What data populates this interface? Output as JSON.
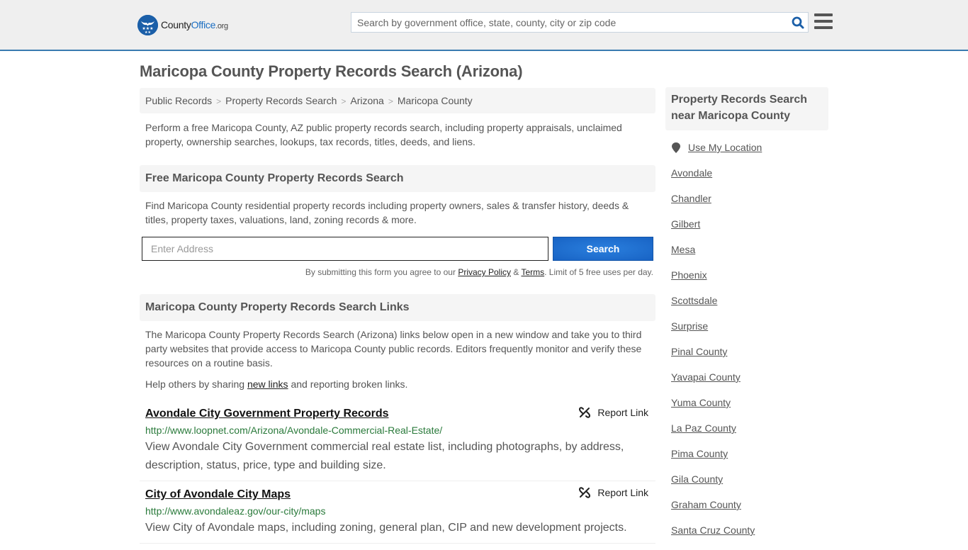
{
  "header": {
    "logo": {
      "county": "County",
      "office": "Office",
      "org": ".org"
    },
    "search_placeholder": "Search by government office, state, county, city or zip code",
    "icons": {
      "search": "search-icon",
      "menu": "hamburger-menu-icon",
      "logo": "eagle-stars-badge"
    },
    "colors": {
      "accent": "#1b6ec2",
      "border": "#3a7bb0"
    }
  },
  "page": {
    "title": "Maricopa County Property Records Search (Arizona)",
    "breadcrumb": [
      "Public Records",
      "Property Records Search",
      "Arizona",
      "Maricopa County"
    ],
    "breadcrumb_sep": ">",
    "intro": "Perform a free Maricopa County, AZ public property records search, including property appraisals, unclaimed property, ownership searches, lookups, tax records, titles, deeds, and liens."
  },
  "search_section": {
    "heading": "Free Maricopa County Property Records Search",
    "description": "Find Maricopa County residential property records including property owners, sales & transfer history, deeds & titles, property taxes, valuations, land, zoning records & more.",
    "address_placeholder": "Enter Address",
    "address_value": "",
    "button_label": "Search",
    "disclaimer_prefix": "By submitting this form you agree to our ",
    "privacy_label": "Privacy Policy",
    "amp": " & ",
    "terms_label": "Terms",
    "disclaimer_suffix": ". Limit of 5 free uses per day."
  },
  "links_section": {
    "heading": "Maricopa County Property Records Search Links",
    "description": "The Maricopa County Property Records Search (Arizona) links below open in a new window and take you to third party websites that provide access to Maricopa County public records. Editors frequently monitor and verify these resources on a routine basis.",
    "help_prefix": "Help others by sharing ",
    "help_link": "new links",
    "help_suffix": " and reporting broken links.",
    "report_label": "Report Link",
    "items": [
      {
        "title": "Avondale City Government Property Records",
        "url": "http://www.loopnet.com/Arizona/Avondale-Commercial-Real-Estate/",
        "description": "View Avondale City Government commercial real estate list, including photographs, by address, description, status, price, type and building size."
      },
      {
        "title": "City of Avondale City Maps",
        "url": "http://www.avondaleaz.gov/our-city/maps",
        "description": "View City of Avondale maps, including zoning, general plan, CIP and new development projects."
      }
    ]
  },
  "sidebar": {
    "heading": "Property Records Search near Maricopa County",
    "use_location": "Use My Location",
    "places": [
      "Avondale",
      "Chandler",
      "Gilbert",
      "Mesa",
      "Phoenix",
      "Scottsdale",
      "Surprise",
      "Pinal County",
      "Yavapai County",
      "Yuma County",
      "La Paz County",
      "Pima County",
      "Gila County",
      "Graham County",
      "Santa Cruz County"
    ]
  }
}
